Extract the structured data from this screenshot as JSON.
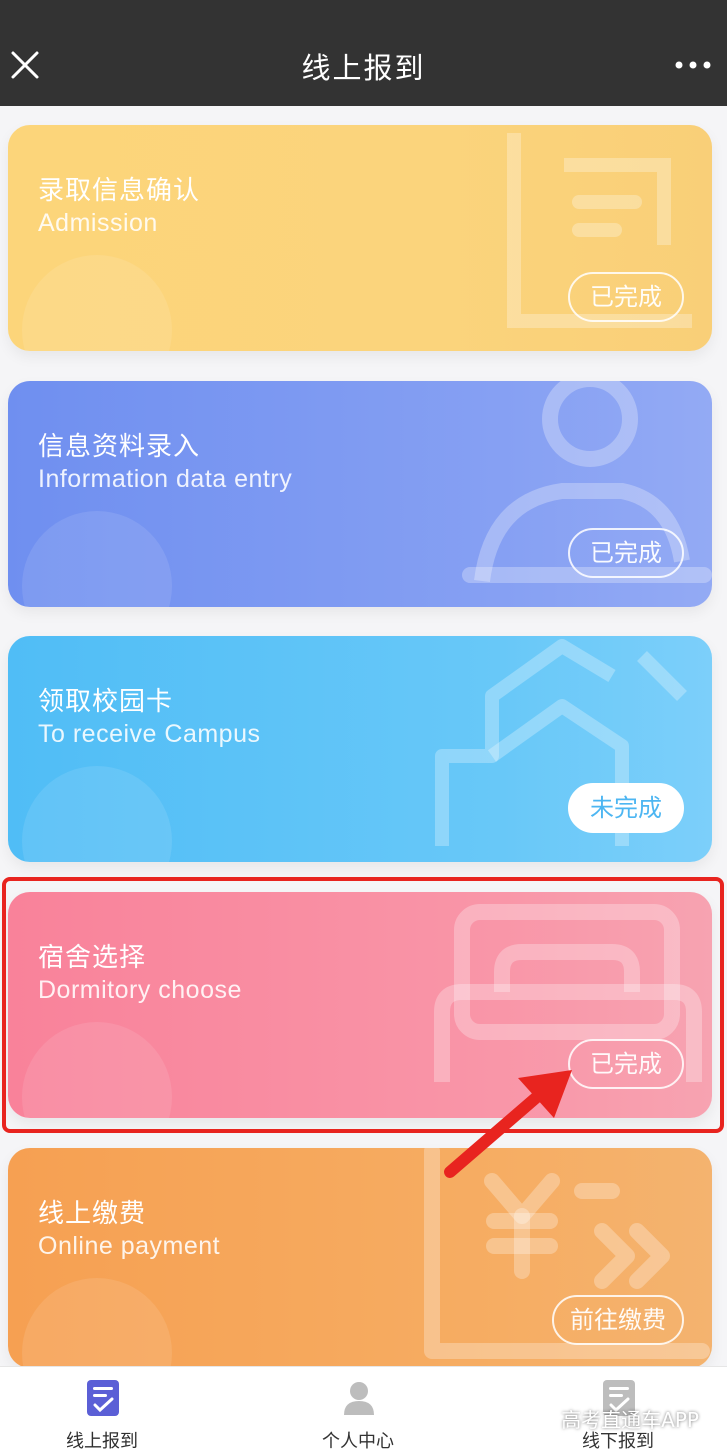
{
  "header": {
    "title": "线上报到",
    "close_icon": "close-icon",
    "more_icon": "more-dots-icon"
  },
  "cards": [
    {
      "title_cn": "录取信息确认",
      "title_en": "Admission",
      "status": "已完成",
      "icon": "document-icon",
      "color": "#fcd57a"
    },
    {
      "title_cn": "信息资料录入",
      "title_en": "Information data entry",
      "status": "已完成",
      "icon": "person-icon",
      "color": "#7c97f1"
    },
    {
      "title_cn": "领取校园卡",
      "title_en": "To receive Campus",
      "status": "未完成",
      "icon": "campus-building-icon",
      "color": "#5cc3f7"
    },
    {
      "title_cn": "宿舍选择",
      "title_en": "Dormitory choose",
      "status": "已完成",
      "icon": "bed-icon",
      "color": "#f98ea3"
    },
    {
      "title_cn": "线上缴费",
      "title_en": "Online payment",
      "status": "前往缴费",
      "icon": "yuan-payment-icon",
      "color": "#f6a65b"
    }
  ],
  "tabbar": {
    "items": [
      {
        "label": "线上报到",
        "icon": "checklist-icon",
        "active": true
      },
      {
        "label": "个人中心",
        "icon": "user-icon",
        "active": false
      },
      {
        "label": "线下报到",
        "icon": "checklist-icon",
        "active": false
      }
    ]
  },
  "watermark": "高考直通车APP",
  "accent_colors": {
    "highlight": "#e8241f",
    "tab_active": "#5b5fd6"
  }
}
